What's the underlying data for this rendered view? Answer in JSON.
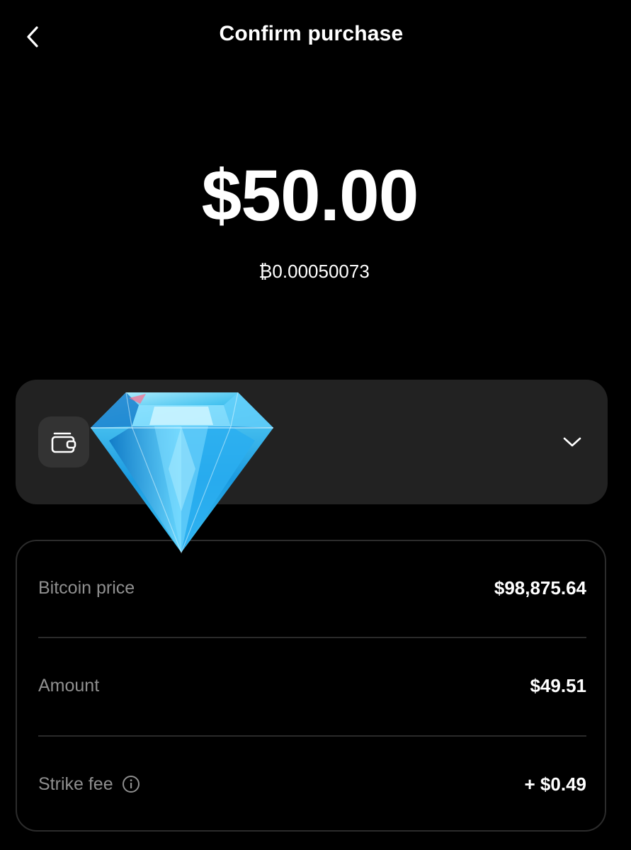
{
  "header": {
    "title": "Confirm purchase",
    "back_icon": "chevron-left-icon"
  },
  "purchase": {
    "amount_usd": "$50.00",
    "amount_btc": "₿0.00050073"
  },
  "wallet_selector": {
    "icon": "wallet-icon",
    "chevron": "chevron-down-icon"
  },
  "overlay": {
    "icon": "diamond-icon"
  },
  "details": {
    "rows": [
      {
        "label": "Bitcoin price",
        "value": "$98,875.64"
      },
      {
        "label": "Amount",
        "value": "$49.51"
      },
      {
        "label": "Strike fee",
        "value": "+ $0.49",
        "info_icon": "info-icon"
      }
    ]
  },
  "colors": {
    "background": "#000000",
    "card": "#222222",
    "icon_box": "#333333",
    "label_gray": "#8f8f8f",
    "border": "#2c2c2c",
    "text": "#ffffff"
  }
}
